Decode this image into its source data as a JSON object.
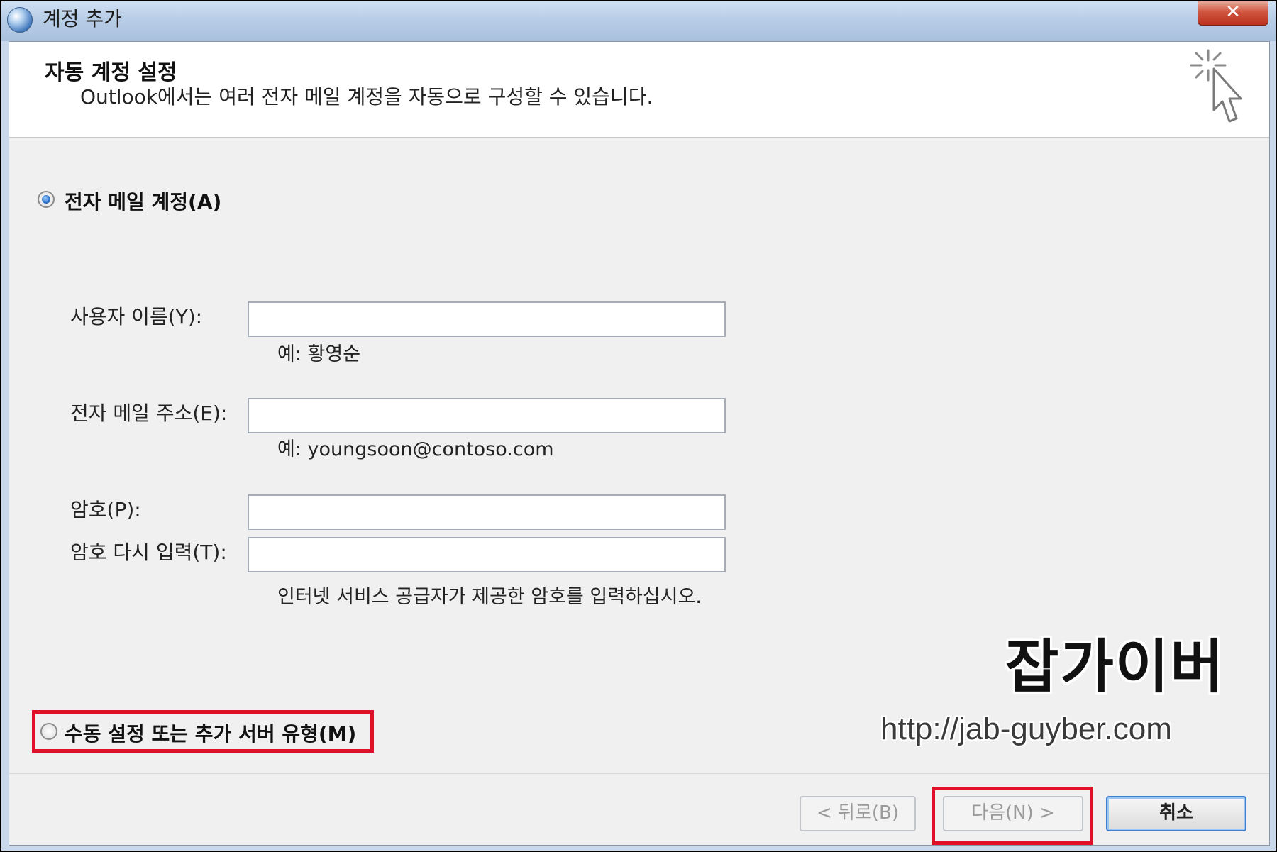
{
  "window": {
    "title": "계정 추가"
  },
  "header": {
    "title": "자동 계정 설정",
    "subtitle": "Outlook에서는 여러 전자 메일 계정을 자동으로 구성할 수 있습니다."
  },
  "options": {
    "email_account": {
      "label": "전자 메일 계정(A)",
      "selected": true
    },
    "manual": {
      "label": "수동 설정 또는 추가 서버 유형(M)",
      "selected": false
    }
  },
  "form": {
    "name": {
      "label": "사용자 이름(Y):",
      "value": "",
      "hint": "예: 황영순"
    },
    "email": {
      "label": "전자 메일 주소(E):",
      "value": "",
      "hint": "예: youngsoon@contoso.com"
    },
    "password": {
      "label": "암호(P):",
      "value": ""
    },
    "password_confirm": {
      "label": "암호 다시 입력(T):",
      "value": ""
    },
    "password_hint": "인터넷 서비스 공급자가 제공한 암호를 입력하십시오."
  },
  "watermark": {
    "brand": "잡가이버",
    "url": "http://jab-guyber.com"
  },
  "buttons": {
    "back": "< 뒤로(B)",
    "next": "다음(N) >",
    "cancel": "취소"
  },
  "colors": {
    "highlight": "#e0102a",
    "accent": "#3f7fcf"
  }
}
